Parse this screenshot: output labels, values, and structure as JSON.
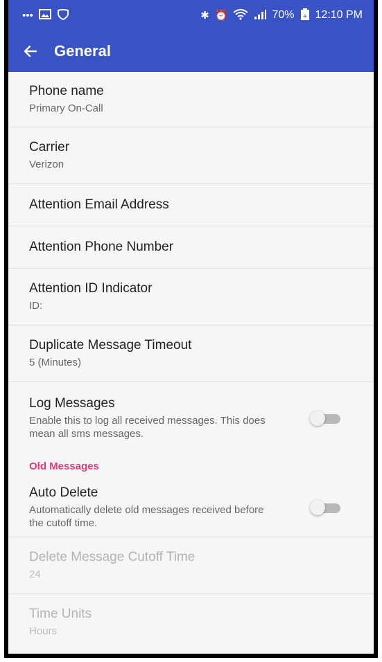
{
  "status_bar": {
    "left_icons": [
      "dots-icon",
      "image-icon",
      "shield-icon"
    ],
    "right_icons": [
      "bluetooth-icon",
      "alarm-icon",
      "wifi-icon",
      "signal-icon"
    ],
    "battery": "70%",
    "time": "12:10 PM"
  },
  "app_bar": {
    "title": "General"
  },
  "settings": {
    "phone_name": {
      "title": "Phone name",
      "value": "Primary On-Call"
    },
    "carrier": {
      "title": "Carrier",
      "value": "Verizon"
    },
    "attention_email": {
      "title": "Attention Email Address"
    },
    "attention_phone": {
      "title": "Attention Phone Number"
    },
    "attention_id": {
      "title": "Attention ID Indicator",
      "value": "ID:"
    },
    "duplicate_timeout": {
      "title": "Duplicate Message Timeout",
      "value": "5 (Minutes)"
    },
    "log_messages": {
      "title": "Log Messages",
      "summary": "Enable this to log all received messages. This does mean all sms messages.",
      "enabled": false
    },
    "old_messages_header": "Old Messages",
    "auto_delete": {
      "title": "Auto Delete",
      "summary": "Automatically delete old messages received before the cutoff time.",
      "enabled": false
    },
    "delete_cutoff": {
      "title": "Delete Message Cutoff Time",
      "value": "24"
    },
    "time_units": {
      "title": "Time Units",
      "value": "Hours"
    }
  },
  "colors": {
    "primary": "#3a53c4",
    "accent": "#e23b7e",
    "background": "#f6f6f6"
  }
}
